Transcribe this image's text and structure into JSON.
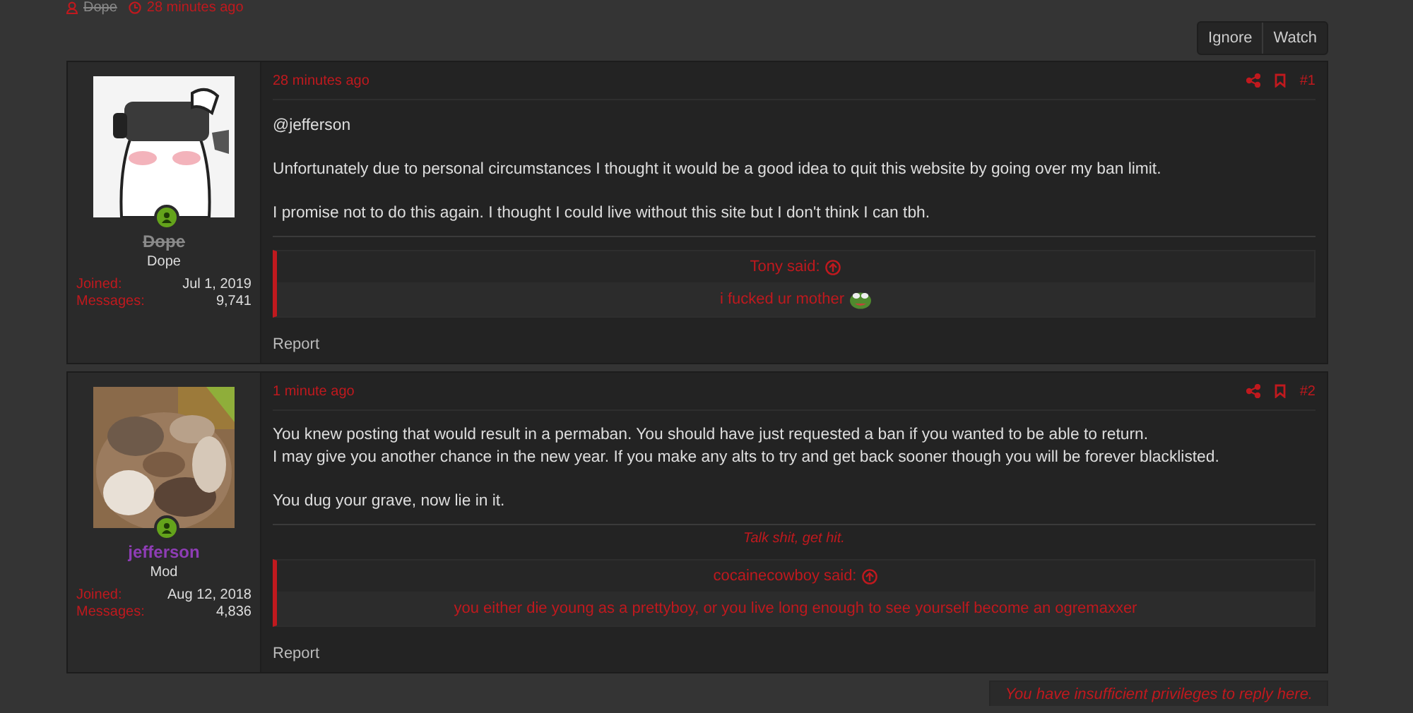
{
  "thread_meta": {
    "author": "Dope",
    "time": "28 minutes ago"
  },
  "actions": [
    {
      "label": "Ignore"
    },
    {
      "label": "Watch"
    }
  ],
  "posts": [
    {
      "user": {
        "name": "Dope",
        "banned": true,
        "color": "#8a8a8a",
        "title": "Dope",
        "online": true,
        "stats": [
          {
            "label": "Joined:",
            "value": "Jul 1, 2019"
          },
          {
            "label": "Messages:",
            "value": "9,741"
          }
        ]
      },
      "time": "28 minutes ago",
      "number": "#1",
      "paragraphs": [
        [
          "@jefferson"
        ],
        [
          "Unfortunately due to personal circumstances I thought it would be a good idea to quit this website by going over my ban limit."
        ],
        [
          "I promise not to do this again. I thought I could live without this site but I don't think I can tbh."
        ]
      ],
      "quote": {
        "author": "Tony said:",
        "text": "i fucked ur mother",
        "emoji": true
      },
      "report": "Report"
    },
    {
      "user": {
        "name": "jefferson",
        "banned": false,
        "color": "#8e3db5",
        "title": "Mod",
        "online": true,
        "stats": [
          {
            "label": "Joined:",
            "value": "Aug 12, 2018"
          },
          {
            "label": "Messages:",
            "value": "4,836"
          }
        ]
      },
      "time": "1 minute ago",
      "number": "#2",
      "paragraphs": [
        [
          "You knew posting that would result in a permaban. You should have just requested a ban if you wanted to be able to return.",
          "I may give you another chance in the new year. If you make any alts to try and get back sooner though you will be forever blacklisted."
        ],
        [
          "You dug your grave, now lie in it."
        ]
      ],
      "signature": "Talk shit, get hit.",
      "quote": {
        "author": "cocainecowboy said:",
        "text": "you either die young as a prettyboy, or you live long enough to see yourself become an ogremaxxer"
      },
      "report": "Report"
    }
  ],
  "reply_notice": "You have insufficient privileges to reply here."
}
